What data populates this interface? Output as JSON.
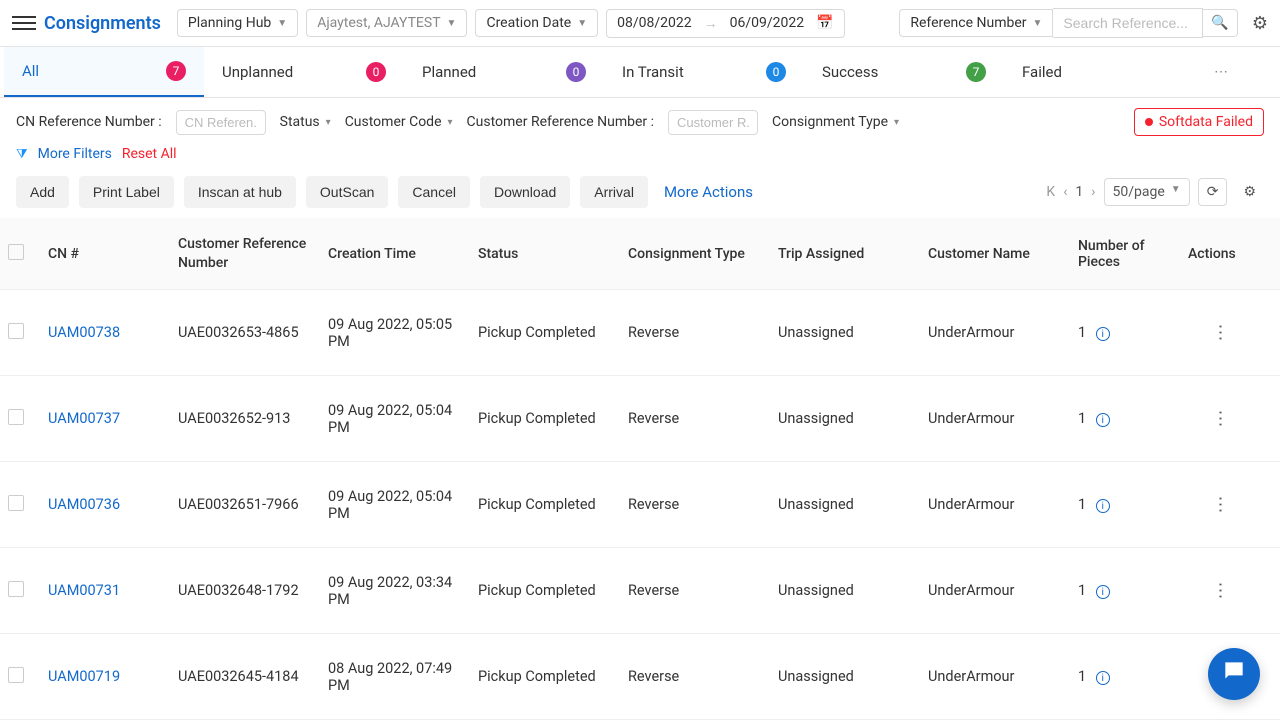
{
  "header": {
    "title": "Consignments",
    "planning_hub": "Planning Hub",
    "hub_value": "Ajaytest, AJAYTEST",
    "date_label": "Creation Date",
    "date_from": "08/08/2022",
    "date_to": "06/09/2022",
    "search_type": "Reference Number",
    "search_placeholder": "Search Reference..."
  },
  "tabs": [
    {
      "label": "All",
      "count": "7",
      "color": "b-pink",
      "active": true
    },
    {
      "label": "Unplanned",
      "count": "0",
      "color": "b-pink",
      "active": false
    },
    {
      "label": "Planned",
      "count": "0",
      "color": "b-purple",
      "active": false
    },
    {
      "label": "In Transit",
      "count": "0",
      "color": "b-blue",
      "active": false
    },
    {
      "label": "Success",
      "count": "7",
      "color": "b-green",
      "active": false
    },
    {
      "label": "Failed",
      "count": "",
      "color": "",
      "active": false
    }
  ],
  "filters": {
    "cn_ref_label": "CN Reference Number :",
    "cn_ref_placeholder": "CN Referen...",
    "status": "Status",
    "customer_code": "Customer Code",
    "cust_ref_label": "Customer Reference Number :",
    "cust_ref_placeholder": "Customer R...",
    "consignment_type": "Consignment Type",
    "softdata_failed": "Softdata Failed",
    "more_filters": "More Filters",
    "reset_all": "Reset All"
  },
  "actions": {
    "add": "Add",
    "print_label": "Print Label",
    "inscan": "Inscan at hub",
    "outscan": "OutScan",
    "cancel": "Cancel",
    "download": "Download",
    "arrival": "Arrival",
    "more": "More Actions",
    "page": "1",
    "page_size": "50/page"
  },
  "columns": {
    "cn": "CN #",
    "cust_ref": "Customer Reference Number",
    "creation": "Creation Time",
    "status": "Status",
    "type": "Consignment Type",
    "trip": "Trip Assigned",
    "customer": "Customer Name",
    "pieces": "Number of Pieces",
    "actions": "Actions"
  },
  "rows": [
    {
      "cn": "UAM00738",
      "ref": "UAE0032653-4865",
      "time": "09 Aug 2022, 05:05 PM",
      "status": "Pickup Completed",
      "type": "Reverse",
      "trip": "Unassigned",
      "customer": "UnderArmour",
      "pieces": "1"
    },
    {
      "cn": "UAM00737",
      "ref": "UAE0032652-913",
      "time": "09 Aug 2022, 05:04 PM",
      "status": "Pickup Completed",
      "type": "Reverse",
      "trip": "Unassigned",
      "customer": "UnderArmour",
      "pieces": "1"
    },
    {
      "cn": "UAM00736",
      "ref": "UAE0032651-7966",
      "time": "09 Aug 2022, 05:04 PM",
      "status": "Pickup Completed",
      "type": "Reverse",
      "trip": "Unassigned",
      "customer": "UnderArmour",
      "pieces": "1"
    },
    {
      "cn": "UAM00731",
      "ref": "UAE0032648-1792",
      "time": "09 Aug 2022, 03:34 PM",
      "status": "Pickup Completed",
      "type": "Reverse",
      "trip": "Unassigned",
      "customer": "UnderArmour",
      "pieces": "1"
    },
    {
      "cn": "UAM00719",
      "ref": "UAE0032645-4184",
      "time": "08 Aug 2022, 07:49 PM",
      "status": "Pickup Completed",
      "type": "Reverse",
      "trip": "Unassigned",
      "customer": "UnderArmour",
      "pieces": "1"
    }
  ]
}
